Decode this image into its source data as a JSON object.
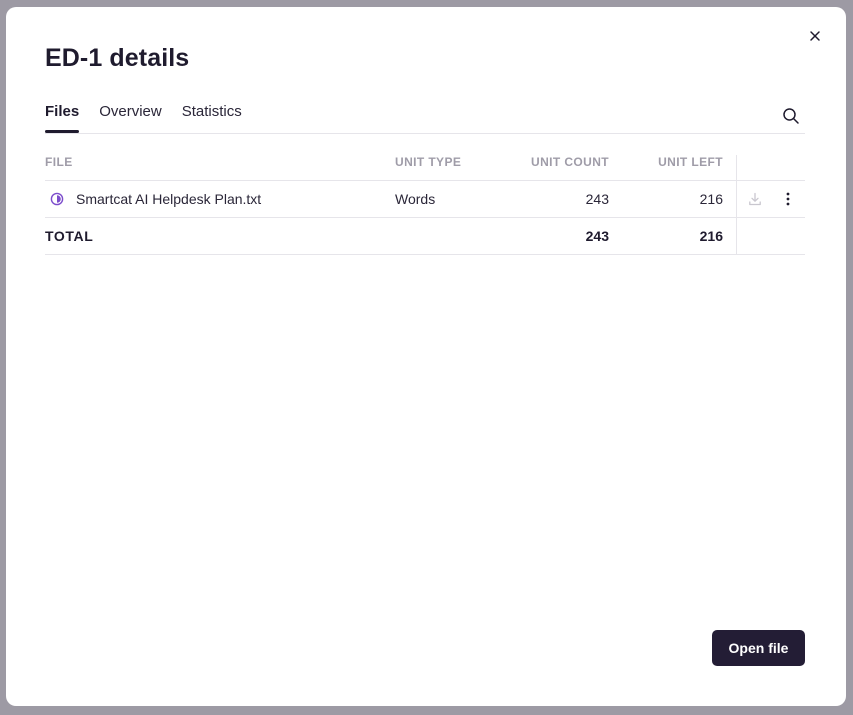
{
  "modal": {
    "title": "ED-1 details",
    "tabs": [
      {
        "label": "Files",
        "active": true
      },
      {
        "label": "Overview",
        "active": false
      },
      {
        "label": "Statistics",
        "active": false
      }
    ],
    "open_button_label": "Open file"
  },
  "table": {
    "headers": {
      "file": "FILE",
      "unit_type": "UNIT TYPE",
      "unit_count": "UNIT COUNT",
      "unit_left": "UNIT LEFT"
    },
    "rows": [
      {
        "file": "Smartcat AI Helpdesk Plan.txt",
        "unit_type": "Words",
        "unit_count": "243",
        "unit_left": "216",
        "progress_icon": "half-circle-progress-icon"
      }
    ],
    "total": {
      "label": "TOTAL",
      "unit_count": "243",
      "unit_left": "216"
    }
  },
  "colors": {
    "accent": "#7c4dcc",
    "primary_button": "#231d35",
    "text": "#1f1b2e",
    "muted_header": "#9f9ca8",
    "divider": "#e6e5ea",
    "backdrop": "#9d9aa4"
  },
  "icons": {
    "close": "close-icon",
    "search": "search-icon",
    "download": "download-icon",
    "more": "kebab-menu-icon"
  }
}
